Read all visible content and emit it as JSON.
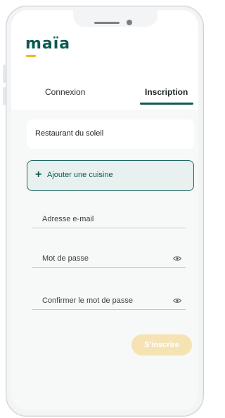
{
  "app": {
    "logo_text": "maïa"
  },
  "tabs": [
    {
      "label": "Connexion",
      "active": false
    },
    {
      "label": "Inscription",
      "active": true
    }
  ],
  "restaurant": {
    "name": "Restaurant du soleil"
  },
  "add_cuisine": {
    "icon": "plus-icon",
    "label": "Ajouter une cuisine"
  },
  "form": {
    "email_label": "Adresse e-mail",
    "password_label": "Mot de passe",
    "confirm_label": "Confirmer le mot de passe",
    "eye_icon": "eye-icon"
  },
  "submit": {
    "label": "S'inscrire",
    "enabled": false
  },
  "colors": {
    "brand_green": "#0d5a50",
    "brand_yellow": "#e9b824",
    "add_cuisine_bg": "#e8f1ef",
    "submit_disabled_bg": "#f6e3b4",
    "screen_bg": "#f7f8f8"
  }
}
